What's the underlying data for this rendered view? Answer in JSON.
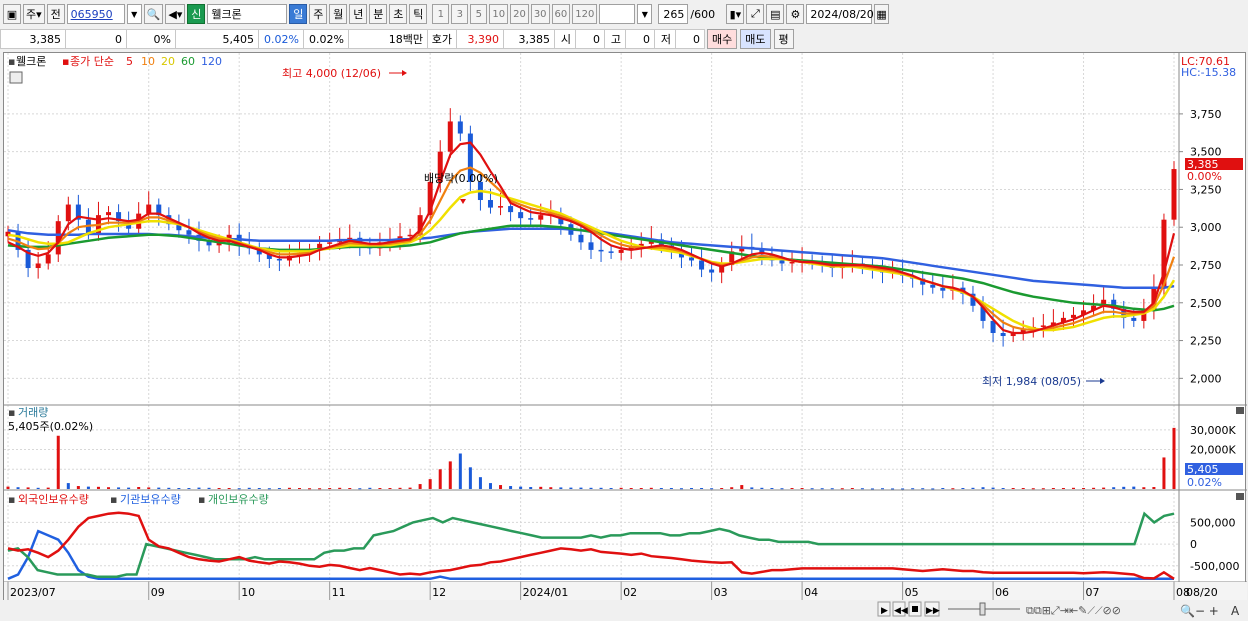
{
  "toolbar": {
    "period_btn": "주",
    "prev_btn": "전",
    "code": "065950",
    "new_badge": "신",
    "name": "웰크론",
    "periods": [
      "일",
      "주",
      "월",
      "년",
      "분",
      "초",
      "틱"
    ],
    "active_period": "일",
    "intervals": [
      "1",
      "3",
      "5",
      "10",
      "20",
      "30",
      "60",
      "120"
    ],
    "count": "265",
    "count_max": "/600",
    "date": "2024/08/20"
  },
  "quote": {
    "price": "3,385",
    "change": "0",
    "change_pct": "0%",
    "volume": "5,405",
    "vol_pct1": "0.02%",
    "vol_pct2": "0.02%",
    "amount": "18백만",
    "hoga_label": "호가",
    "hoga": "3,390",
    "hoga2": "3,385",
    "open_label": "시",
    "open": "0",
    "high_label": "고",
    "high": "0",
    "low_label": "저",
    "low": "0",
    "buy": "매수",
    "sell": "매도",
    "avg": "평"
  },
  "colors": {
    "up": "#e01010",
    "down": "#1a5ad8",
    "ma5": "#e01010",
    "ma10": "#f08010",
    "ma20": "#f0e000",
    "ma60": "#1a9a30",
    "ma120": "#3060e0",
    "foreign": "#e01010",
    "inst": "#2060e0",
    "indiv": "#2a9a5a"
  },
  "chart_data": {
    "type": "candlestick",
    "price_panel": {
      "legend_name": "웰크론",
      "legend_series": "종가 단순",
      "ma_periods": [
        "5",
        "10",
        "20",
        "60",
        "120"
      ],
      "yticks": [
        "3,750",
        "3,500",
        "3,250",
        "3,000",
        "2,750",
        "2,500",
        "2,250",
        "2,000"
      ],
      "ylim": [
        1850,
        4100
      ],
      "lc": "LC:70.61",
      "hc": "HC:-15.38",
      "last_price": "3,385",
      "last_pct": "0.00%",
      "high_annot": "최고 4,000 (12/06)",
      "low_annot": "최저 1,984 (08/05)",
      "div_annot": "배당락(0.00%)",
      "high_value": 4000,
      "low_value": 1984,
      "close_series": [
        2970,
        2850,
        2730,
        2760,
        2820,
        3040,
        3150,
        3050,
        2960,
        3080,
        3100,
        3040,
        2990,
        3090,
        3150,
        3080,
        3020,
        2980,
        2950,
        2910,
        2880,
        2900,
        2950,
        2880,
        2860,
        2820,
        2790,
        2780,
        2810,
        2830,
        2850,
        2890,
        2900,
        2920,
        2930,
        2880,
        2860,
        2900,
        2920,
        2940,
        2950,
        3080,
        3300,
        3500,
        3700,
        3620,
        3300,
        3180,
        3130,
        3140,
        3100,
        3060,
        3050,
        3080,
        3090,
        3020,
        2950,
        2900,
        2850,
        2840,
        2830,
        2850,
        2870,
        2890,
        2920,
        2880,
        2850,
        2800,
        2780,
        2720,
        2700,
        2750,
        2840,
        2870,
        2860,
        2820,
        2780,
        2760,
        2770,
        2780,
        2760,
        2750,
        2730,
        2740,
        2760,
        2740,
        2720,
        2700,
        2700,
        2680,
        2660,
        2620,
        2600,
        2580,
        2600,
        2560,
        2480,
        2380,
        2300,
        2280,
        2300,
        2330,
        2340,
        2350,
        2370,
        2400,
        2420,
        2450,
        2480,
        2520,
        2460,
        2400,
        2380,
        2450,
        2600,
        3050,
        3385
      ],
      "ma5": [
        2900,
        2870,
        2830,
        2810,
        2830,
        2900,
        3020,
        3070,
        3060,
        3050,
        3060,
        3050,
        3040,
        3050,
        3090,
        3090,
        3060,
        3030,
        3000,
        2960,
        2930,
        2910,
        2910,
        2890,
        2870,
        2850,
        2820,
        2800,
        2800,
        2810,
        2820,
        2850,
        2870,
        2890,
        2910,
        2900,
        2890,
        2890,
        2900,
        2910,
        2920,
        2980,
        3110,
        3300,
        3480,
        3550,
        3560,
        3480,
        3370,
        3270,
        3160,
        3130,
        3100,
        3090,
        3080,
        3060,
        3040,
        3010,
        2970,
        2920,
        2880,
        2860,
        2850,
        2860,
        2870,
        2880,
        2870,
        2850,
        2820,
        2790,
        2760,
        2740,
        2760,
        2790,
        2820,
        2830,
        2820,
        2800,
        2780,
        2770,
        2770,
        2760,
        2750,
        2750,
        2750,
        2750,
        2740,
        2730,
        2720,
        2700,
        2680,
        2650,
        2630,
        2610,
        2600,
        2580,
        2540,
        2470,
        2390,
        2320,
        2300,
        2300,
        2310,
        2330,
        2350,
        2370,
        2390,
        2420,
        2450,
        2480,
        2470,
        2450,
        2440,
        2440,
        2500,
        2700,
        2960
      ],
      "ma20": [
        2950,
        2940,
        2920,
        2900,
        2890,
        2890,
        2900,
        2930,
        2960,
        2980,
        3000,
        3010,
        3020,
        3030,
        3040,
        3040,
        3030,
        3020,
        3000,
        2980,
        2960,
        2940,
        2920,
        2900,
        2880,
        2860,
        2850,
        2840,
        2840,
        2840,
        2840,
        2850,
        2860,
        2870,
        2880,
        2880,
        2880,
        2880,
        2880,
        2890,
        2900,
        2930,
        2980,
        3050,
        3130,
        3200,
        3230,
        3240,
        3230,
        3210,
        3190,
        3170,
        3150,
        3130,
        3110,
        3090,
        3060,
        3030,
        3000,
        2970,
        2940,
        2910,
        2890,
        2870,
        2860,
        2850,
        2840,
        2830,
        2810,
        2790,
        2770,
        2760,
        2760,
        2770,
        2780,
        2790,
        2790,
        2790,
        2780,
        2770,
        2760,
        2750,
        2740,
        2740,
        2740,
        2730,
        2720,
        2710,
        2700,
        2690,
        2670,
        2650,
        2630,
        2610,
        2590,
        2570,
        2540,
        2500,
        2460,
        2420,
        2380,
        2350,
        2330,
        2320,
        2320,
        2330,
        2340,
        2360,
        2380,
        2400,
        2410,
        2410,
        2420,
        2430,
        2460,
        2540,
        2650
      ],
      "ma60": [
        2880,
        2875,
        2870,
        2870,
        2870,
        2880,
        2890,
        2900,
        2910,
        2920,
        2930,
        2935,
        2940,
        2945,
        2950,
        2950,
        2945,
        2940,
        2930,
        2920,
        2910,
        2900,
        2890,
        2880,
        2870,
        2860,
        2855,
        2850,
        2850,
        2850,
        2850,
        2855,
        2860,
        2865,
        2870,
        2870,
        2870,
        2870,
        2870,
        2875,
        2880,
        2890,
        2900,
        2920,
        2940,
        2960,
        2970,
        2980,
        2990,
        3000,
        3010,
        3010,
        3010,
        3010,
        3005,
        3000,
        2990,
        2980,
        2970,
        2960,
        2950,
        2940,
        2930,
        2920,
        2910,
        2900,
        2890,
        2880,
        2870,
        2860,
        2850,
        2840,
        2830,
        2820,
        2810,
        2800,
        2795,
        2790,
        2785,
        2780,
        2775,
        2770,
        2765,
        2760,
        2755,
        2750,
        2745,
        2740,
        2730,
        2720,
        2710,
        2700,
        2690,
        2680,
        2670,
        2660,
        2645,
        2630,
        2610,
        2590,
        2570,
        2555,
        2540,
        2530,
        2520,
        2510,
        2500,
        2495,
        2490,
        2485,
        2480,
        2470,
        2460,
        2455,
        2450,
        2460,
        2480
      ],
      "ma120": [
        2980,
        2970,
        2960,
        2955,
        2950,
        2950,
        2950,
        2950,
        2955,
        2955,
        2955,
        2955,
        2955,
        2955,
        2955,
        2950,
        2950,
        2945,
        2940,
        2935,
        2930,
        2925,
        2920,
        2920,
        2915,
        2910,
        2910,
        2910,
        2910,
        2910,
        2910,
        2910,
        2910,
        2915,
        2915,
        2915,
        2915,
        2915,
        2915,
        2920,
        2920,
        2925,
        2930,
        2940,
        2950,
        2960,
        2970,
        2975,
        2980,
        2985,
        2990,
        2990,
        2990,
        2990,
        2990,
        2990,
        2985,
        2980,
        2975,
        2970,
        2960,
        2950,
        2940,
        2930,
        2920,
        2910,
        2900,
        2895,
        2890,
        2885,
        2880,
        2875,
        2870,
        2865,
        2860,
        2855,
        2850,
        2845,
        2840,
        2835,
        2830,
        2825,
        2820,
        2815,
        2810,
        2805,
        2800,
        2795,
        2785,
        2775,
        2765,
        2755,
        2745,
        2735,
        2725,
        2715,
        2705,
        2695,
        2685,
        2675,
        2665,
        2655,
        2645,
        2640,
        2635,
        2630,
        2625,
        2620,
        2615,
        2610,
        2605,
        2600,
        2600,
        2600,
        2600,
        2600,
        2610
      ]
    },
    "volume_panel": {
      "title": "거래량",
      "subtitle": "5,405주(0.02%)",
      "yticks": [
        "30,000K",
        "20,000K",
        "10,000K"
      ],
      "last_value": "5,405",
      "last_pct": "0.02%",
      "ylim": [
        0,
        36000
      ],
      "values": [
        1200,
        900,
        800,
        600,
        700,
        27000,
        3000,
        1500,
        1200,
        1100,
        900,
        800,
        700,
        1000,
        800,
        700,
        600,
        500,
        500,
        700,
        600,
        500,
        500,
        400,
        600,
        500,
        400,
        500,
        600,
        500,
        400,
        400,
        500,
        600,
        500,
        400,
        600,
        500,
        500,
        600,
        700,
        2500,
        5000,
        10000,
        14000,
        18000,
        11000,
        6000,
        3000,
        2000,
        1500,
        1200,
        1000,
        1100,
        900,
        800,
        700,
        700,
        600,
        600,
        500,
        600,
        500,
        500,
        600,
        500,
        500,
        400,
        500,
        500,
        400,
        500,
        900,
        2000,
        800,
        600,
        500,
        400,
        500,
        500,
        400,
        400,
        400,
        400,
        500,
        400,
        300,
        400,
        300,
        300,
        400,
        400,
        300,
        500,
        400,
        500,
        600,
        900,
        700,
        500,
        500,
        500,
        400,
        400,
        500,
        500,
        600,
        500,
        600,
        700,
        900,
        1100,
        1200,
        900,
        1000,
        16000,
        31000,
        6000,
        5405
      ],
      "up_flags": [
        1,
        0,
        1,
        0,
        1,
        1,
        0,
        1,
        0,
        1,
        1,
        0,
        0,
        1,
        1,
        0,
        0,
        0,
        0,
        0,
        0,
        1,
        1,
        0,
        0,
        0,
        0,
        0,
        1,
        1,
        1,
        1,
        1,
        1,
        1,
        0,
        0,
        1,
        1,
        1,
        1,
        1,
        1,
        1,
        1,
        0,
        0,
        0,
        0,
        1,
        0,
        0,
        0,
        1,
        1,
        0,
        0,
        0,
        0,
        0,
        0,
        1,
        1,
        1,
        1,
        0,
        0,
        0,
        0,
        0,
        0,
        1,
        1,
        1,
        0,
        0,
        0,
        0,
        1,
        1,
        0,
        0,
        0,
        1,
        1,
        0,
        0,
        0,
        0,
        0,
        0,
        0,
        0,
        0,
        1,
        0,
        0,
        0,
        0,
        0,
        1,
        1,
        1,
        1,
        1,
        1,
        1,
        1,
        1,
        1,
        0,
        0,
        0,
        1,
        1,
        1,
        1
      ]
    },
    "holdings_panel": {
      "legend": [
        "외국인보유수량",
        "기관보유수량",
        "개인보유수량"
      ],
      "yticks": [
        "500,000",
        "0",
        "-500,000"
      ],
      "ylim": [
        -850000,
        900000
      ],
      "foreign": [
        -100000,
        -150000,
        -120000,
        -200000,
        -300000,
        -150000,
        100000,
        400000,
        600000,
        650000,
        700000,
        720000,
        700000,
        650000,
        100000,
        -50000,
        -100000,
        -200000,
        -300000,
        -350000,
        -380000,
        -400000,
        -350000,
        -300000,
        -380000,
        -420000,
        -450000,
        -400000,
        -420000,
        -450000,
        -500000,
        -520000,
        -480000,
        -500000,
        -550000,
        -600000,
        -550000,
        -600000,
        -650000,
        -700000,
        -680000,
        -700000,
        -650000,
        -620000,
        -600000,
        -550000,
        -500000,
        -480000,
        -420000,
        -400000,
        -350000,
        -300000,
        -250000,
        -200000,
        -150000,
        -100000,
        -120000,
        -150000,
        -120000,
        -180000,
        -200000,
        -220000,
        -250000,
        -220000,
        -280000,
        -300000,
        -320000,
        -350000,
        -380000,
        -400000,
        -420000,
        -430000,
        -420000,
        -650000,
        -680000,
        -640000,
        -600000,
        -600000,
        -580000,
        -560000,
        -560000,
        -560000,
        -560000,
        -560000,
        -560000,
        -560000,
        -560000,
        -560000,
        -560000,
        -580000,
        -600000,
        -620000,
        -600000,
        -580000,
        -600000,
        -620000,
        -620000,
        -650000,
        -660000,
        -660000,
        -660000,
        -660000,
        -660000,
        -660000,
        -660000,
        -660000,
        -660000,
        -670000,
        -660000,
        -650000,
        -660000,
        -680000,
        -700000,
        -780000,
        -790000,
        -650000,
        -800000
      ],
      "inst": [
        -800000,
        -700000,
        -300000,
        300000,
        200000,
        100000,
        -200000,
        -600000,
        -750000,
        -800000,
        -800000,
        -800000,
        -800000,
        -800000,
        -800000,
        -800000,
        -800000,
        -800000,
        -800000,
        -800000,
        -800000,
        -800000,
        -800000,
        -800000,
        -800000,
        -800000,
        -800000,
        -800000,
        -800000,
        -800000,
        -800000,
        -800000,
        -800000,
        -800000,
        -800000,
        -800000,
        -800000,
        -800000,
        -800000,
        -800000,
        -800000,
        -800000,
        -800000,
        -750000,
        -800000,
        -800000,
        -800000,
        -800000,
        -800000,
        -800000,
        -800000,
        -800000,
        -800000,
        -800000,
        -800000,
        -800000,
        -800000,
        -800000,
        -800000,
        -800000,
        -800000,
        -800000,
        -800000,
        -800000,
        -800000,
        -800000,
        -800000,
        -800000,
        -800000,
        -800000,
        -800000,
        -800000,
        -800000,
        -800000,
        -800000,
        -800000,
        -800000,
        -800000,
        -800000,
        -800000,
        -800000,
        -800000,
        -800000,
        -800000,
        -800000,
        -800000,
        -800000,
        -800000,
        -800000,
        -800000,
        -800000,
        -800000,
        -800000,
        -800000,
        -800000,
        -800000,
        -800000,
        -800000,
        -800000,
        -800000,
        -800000,
        -800000,
        -800000,
        -800000,
        -800000,
        -800000,
        -800000,
        -800000,
        -800000,
        -800000,
        -800000,
        -800000,
        -800000,
        -800000,
        -800000,
        -800000,
        -800000
      ],
      "indiv": [
        -150000,
        -100000,
        -300000,
        -600000,
        -650000,
        -700000,
        -700000,
        -700000,
        -700000,
        -750000,
        -750000,
        -750000,
        -700000,
        -700000,
        0,
        -50000,
        -100000,
        -150000,
        -200000,
        -250000,
        -300000,
        -350000,
        -350000,
        -350000,
        -350000,
        -300000,
        -350000,
        -350000,
        -350000,
        -350000,
        -350000,
        -350000,
        -200000,
        -150000,
        -150000,
        -100000,
        -100000,
        200000,
        250000,
        300000,
        400000,
        500000,
        550000,
        600000,
        500000,
        600000,
        550000,
        500000,
        450000,
        400000,
        350000,
        300000,
        250000,
        200000,
        150000,
        150000,
        150000,
        150000,
        150000,
        200000,
        150000,
        200000,
        200000,
        250000,
        250000,
        250000,
        250000,
        200000,
        200000,
        250000,
        250000,
        300000,
        350000,
        300000,
        200000,
        150000,
        100000,
        100000,
        50000,
        50000,
        50000,
        50000,
        0,
        0,
        0,
        0,
        0,
        0,
        0,
        0,
        0,
        0,
        0,
        0,
        0,
        0,
        0,
        0,
        0,
        0,
        0,
        0,
        0,
        0,
        0,
        0,
        0,
        0,
        0,
        0,
        0,
        0,
        0,
        0,
        0,
        700000,
        500000,
        650000,
        700000
      ]
    },
    "x_ticks": [
      "2023/07",
      "09",
      "10",
      "11",
      "12",
      "2024/01",
      "02",
      "03",
      "04",
      "05",
      "06",
      "07",
      "08"
    ],
    "x_tick_index": [
      0,
      14,
      23,
      32,
      42,
      51,
      61,
      70,
      79,
      89,
      98,
      107,
      116
    ],
    "x_last_label": "08/20"
  }
}
